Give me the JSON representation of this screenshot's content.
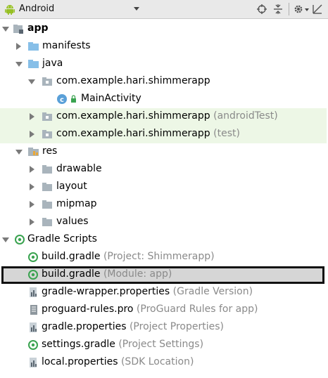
{
  "toolbar": {
    "view_selector": "Android",
    "android_icon_color": "#97c024"
  },
  "colors": {
    "folder_blue": "#87bfe8",
    "package_gray": "#a9b4bc",
    "gradle_green": "#3aa350",
    "class_blue": "#5aa0d8",
    "test_row_green": "#edf7e6",
    "selection_gray": "#d6d6d6",
    "hint_gray": "#8a8a8a"
  },
  "tree": {
    "app": "app",
    "manifests": "manifests",
    "java": "java",
    "pkg_main": "com.example.hari.shimmerapp",
    "main_activity": "MainActivity",
    "pkg_android_test": "com.example.hari.shimmerapp",
    "pkg_android_test_hint": "(androidTest)",
    "pkg_test": "com.example.hari.shimmerapp",
    "pkg_test_hint": "(test)",
    "res": "res",
    "drawable": "drawable",
    "layout": "layout",
    "mipmap": "mipmap",
    "values": "values",
    "gradle_scripts": "Gradle Scripts",
    "build_gradle_project": "build.gradle",
    "build_gradle_project_hint": "(Project: Shimmerapp)",
    "build_gradle_module": "build.gradle",
    "build_gradle_module_hint": "(Module: app)",
    "gradle_wrapper": "gradle-wrapper.properties",
    "gradle_wrapper_hint": "(Gradle Version)",
    "proguard": "proguard-rules.pro",
    "proguard_hint": "(ProGuard Rules for app)",
    "gradle_properties": "gradle.properties",
    "gradle_properties_hint": "(Project Properties)",
    "settings_gradle": "settings.gradle",
    "settings_gradle_hint": "(Project Settings)",
    "local_properties": "local.properties",
    "local_properties_hint": "(SDK Location)"
  }
}
